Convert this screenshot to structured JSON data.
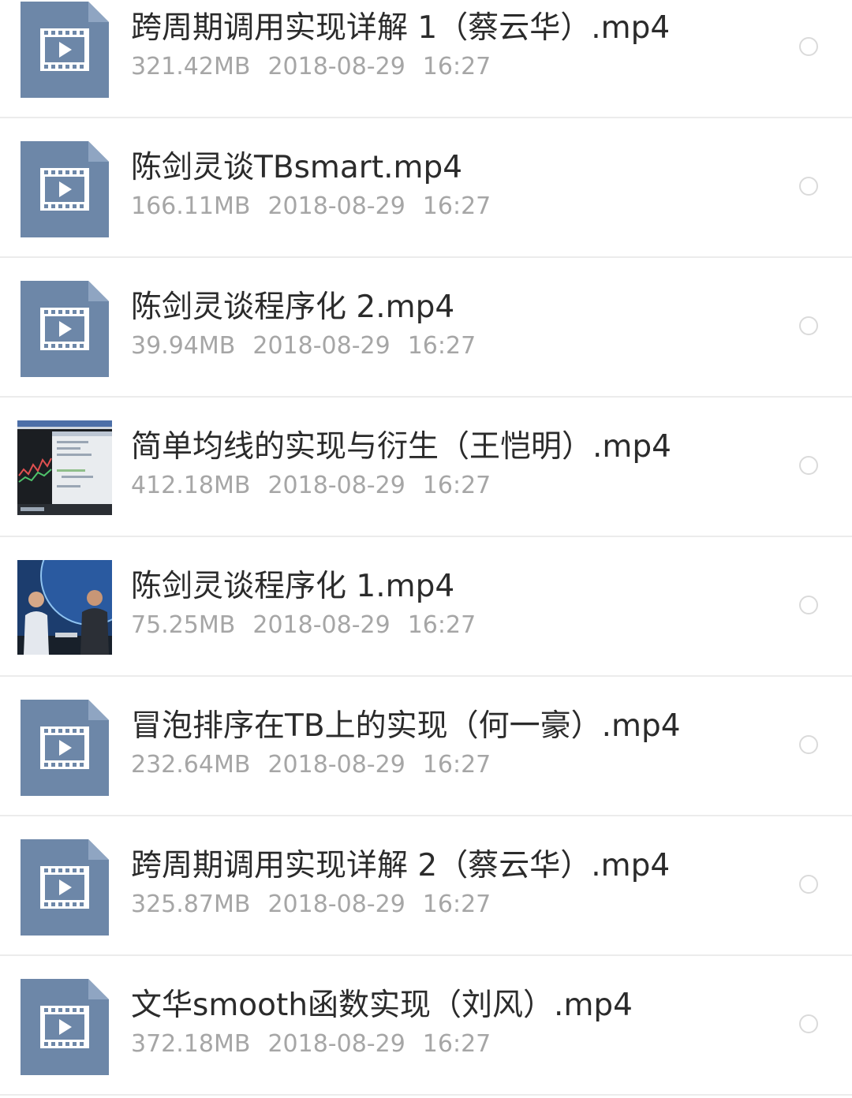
{
  "files": [
    {
      "name": "跨周期调用实现详解 1（蔡云华）.mp4",
      "size": "321.42MB",
      "date": "2018-08-29",
      "time": "16:27",
      "icon": "video-file-icon"
    },
    {
      "name": "陈剑灵谈TBsmart.mp4",
      "size": "166.11MB",
      "date": "2018-08-29",
      "time": "16:27",
      "icon": "video-file-icon"
    },
    {
      "name": "陈剑灵谈程序化 2.mp4",
      "size": "39.94MB",
      "date": "2018-08-29",
      "time": "16:27",
      "icon": "video-file-icon"
    },
    {
      "name": "简单均线的实现与衍生（王恺明）.mp4",
      "size": "412.18MB",
      "date": "2018-08-29",
      "time": "16:27",
      "icon": "trading-chart-thumbnail"
    },
    {
      "name": "陈剑灵谈程序化 1.mp4",
      "size": "75.25MB",
      "date": "2018-08-29",
      "time": "16:27",
      "icon": "interview-thumbnail"
    },
    {
      "name": "冒泡排序在TB上的实现（何一豪）.mp4",
      "size": "232.64MB",
      "date": "2018-08-29",
      "time": "16:27",
      "icon": "video-file-icon"
    },
    {
      "name": "跨周期调用实现详解 2（蔡云华）.mp4",
      "size": "325.87MB",
      "date": "2018-08-29",
      "time": "16:27",
      "icon": "video-file-icon"
    },
    {
      "name": "文华smooth函数实现（刘风）.mp4",
      "size": "372.18MB",
      "date": "2018-08-29",
      "time": "16:27",
      "icon": "video-file-icon"
    }
  ],
  "colors": {
    "icon_fill": "#6d87a8",
    "icon_fold": "#8fa5c2",
    "name_text": "#2b2b2b",
    "meta_text": "#a6a6a6",
    "divider": "#ececec",
    "radio_border": "#dadada"
  }
}
